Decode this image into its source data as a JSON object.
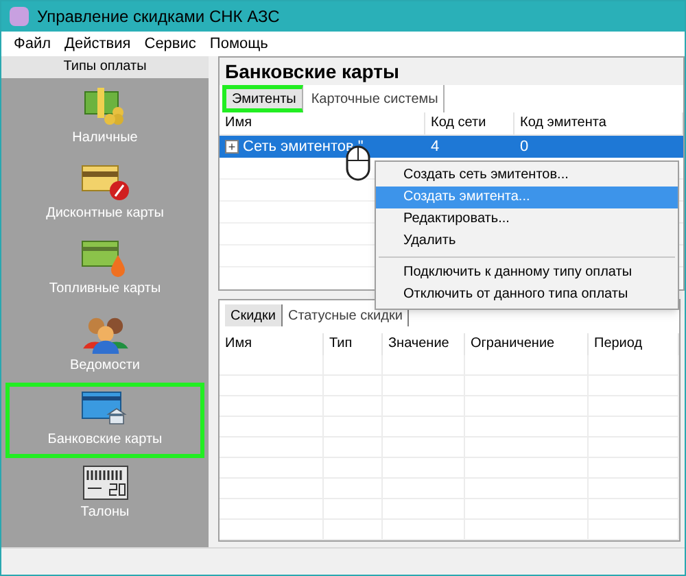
{
  "window": {
    "title": "Управление скидками СНК АЗС"
  },
  "menu": [
    "Файл",
    "Действия",
    "Сервис",
    "Помощь"
  ],
  "sidebar": {
    "title": "Типы оплаты",
    "items": [
      {
        "label": "Наличные",
        "kind": "cash",
        "highlighted": false
      },
      {
        "label": "Дисконтные карты",
        "kind": "discount",
        "highlighted": false
      },
      {
        "label": "Топливные карты",
        "kind": "fuel",
        "highlighted": false
      },
      {
        "label": "Ведомости",
        "kind": "people",
        "highlighted": false
      },
      {
        "label": "Банковские карты",
        "kind": "bank",
        "highlighted": true
      },
      {
        "label": "Талоны",
        "kind": "coupon",
        "highlighted": false
      }
    ]
  },
  "panel": {
    "title": "Банковские карты",
    "tabs": [
      {
        "label": "Эмитенты",
        "selected": true,
        "highlighted": true
      },
      {
        "label": "Карточные системы",
        "selected": false,
        "highlighted": false
      }
    ],
    "table": {
      "columns": [
        "Имя",
        "Код сети",
        "Код эмитента"
      ],
      "rows": [
        {
          "cells": [
            "Сеть эмитентов \"",
            "4",
            "0"
          ],
          "selected": true,
          "expander": "+"
        }
      ]
    },
    "context_menu": [
      {
        "label": "Создать сеть эмитентов...",
        "selected": false,
        "kind": "item"
      },
      {
        "label": "Создать эмитента...",
        "selected": true,
        "kind": "item"
      },
      {
        "label": "Редактировать...",
        "selected": false,
        "kind": "item"
      },
      {
        "label": "Удалить",
        "selected": false,
        "kind": "item"
      },
      {
        "kind": "separator"
      },
      {
        "label": "Подключить к данному типу оплаты",
        "selected": false,
        "kind": "item"
      },
      {
        "label": "Отключить от данного типа оплаты",
        "selected": false,
        "kind": "item"
      }
    ]
  },
  "discounts": {
    "tabs": [
      {
        "label": "Скидки",
        "selected": true
      },
      {
        "label": "Статусные скидки",
        "selected": false
      }
    ],
    "columns": [
      "Имя",
      "Тип",
      "Значение",
      "Ограничение",
      "Период"
    ]
  }
}
